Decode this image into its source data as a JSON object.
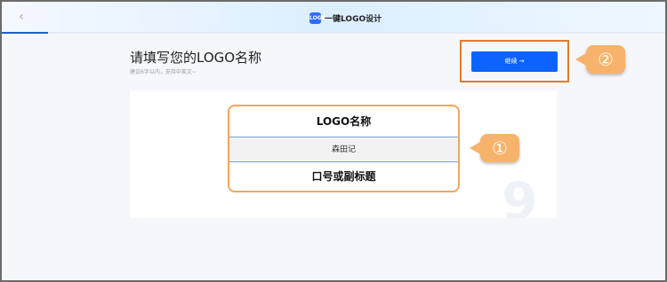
{
  "header": {
    "back_glyph": "‹",
    "brand_logo_text": "LOGO",
    "brand_title": "一键LOGO设计",
    "progress": 0.07
  },
  "main": {
    "title": "请填写您的LOGO名称",
    "subtitle": "建议6字以内，支持中英文~",
    "continue_label": "继续 →"
  },
  "callouts": {
    "one": "①",
    "two": "②"
  },
  "card": {
    "name_label": "LOGO名称",
    "name_value": "森田记",
    "slogan_label": "口号或副标题"
  },
  "colors": {
    "accent": "#0d63ff",
    "highlight": "#f2a75c",
    "callout": "#f7b36b"
  }
}
